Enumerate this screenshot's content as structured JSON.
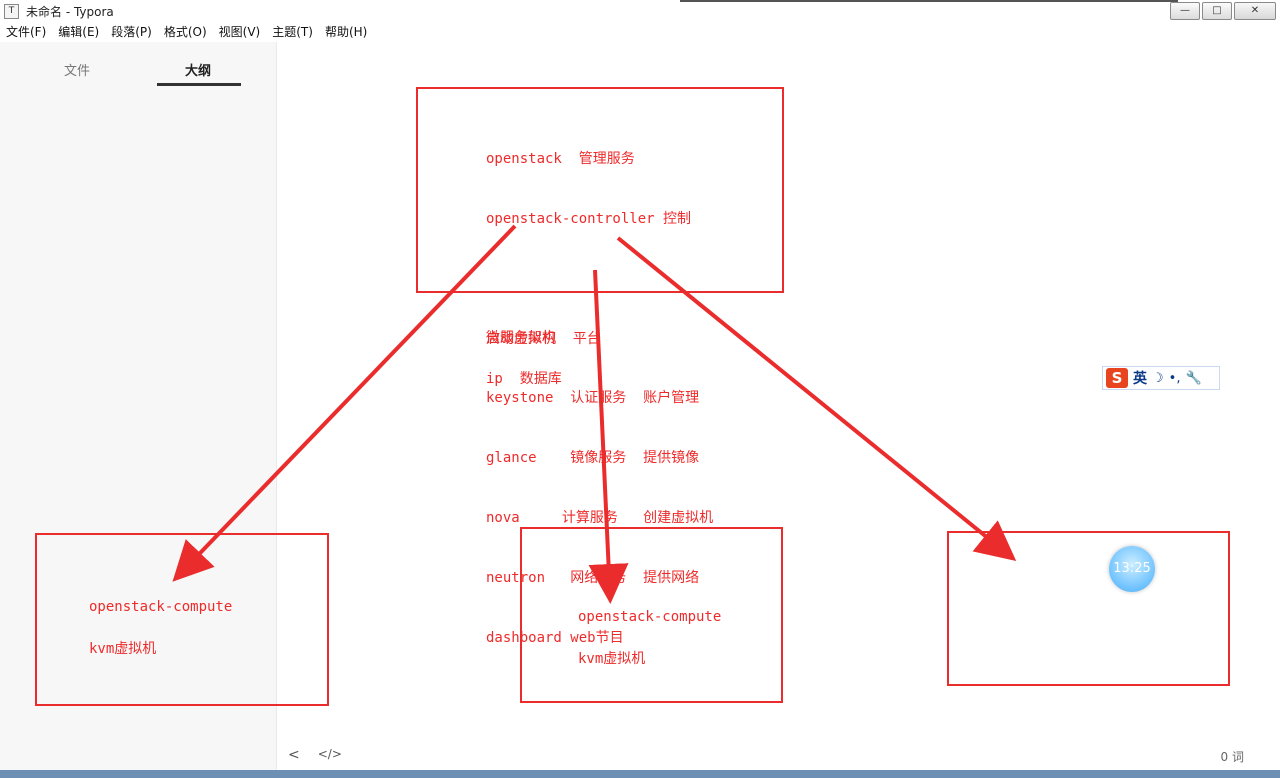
{
  "window": {
    "title": "未命名 - Typora",
    "app_icon": "T",
    "buttons": {
      "minimize": "—",
      "maximize": "□",
      "close": "✕"
    }
  },
  "menu": [
    "文件(F)",
    "编辑(E)",
    "段落(P)",
    "格式(O)",
    "视图(V)",
    "主题(T)",
    "帮助(H)"
  ],
  "sidebar": {
    "tab_files": "文件",
    "tab_outline": "大纲",
    "active_tab": "大纲"
  },
  "editor": {
    "word_count": "0 词",
    "source_toggle": "</>",
    "sidebar_toggle": "<"
  },
  "drawing": {
    "top_box_lines": [
      "openstack  管理服务",
      "openstack-controller 控制",
      "",
      "微服务架构",
      "keystone  认证服务  账户管理",
      "glance    镜像服务  提供镜像",
      "nova     计算服务   创建虚拟机",
      "neutron   网络服务  提供网络",
      "dashboard web节目"
    ],
    "line_start_vm": "启动虚拟机  平台",
    "line_ip_db": "ip  数据库",
    "left_box": {
      "line1": "openstack-compute",
      "line2": "kvm虚拟机"
    },
    "center_box": {
      "line1": "openstack-compute",
      "line2": "kvm虚拟机"
    },
    "right_box": {}
  },
  "ime": {
    "logo": "S",
    "lang": "英",
    "moon": "☽",
    "punct": "•,",
    "wrench": "🔧"
  },
  "clock": {
    "time": "13:25"
  },
  "colors": {
    "annotation": "#ea2c2c",
    "sidebar_bg": "#f7f7f7"
  }
}
